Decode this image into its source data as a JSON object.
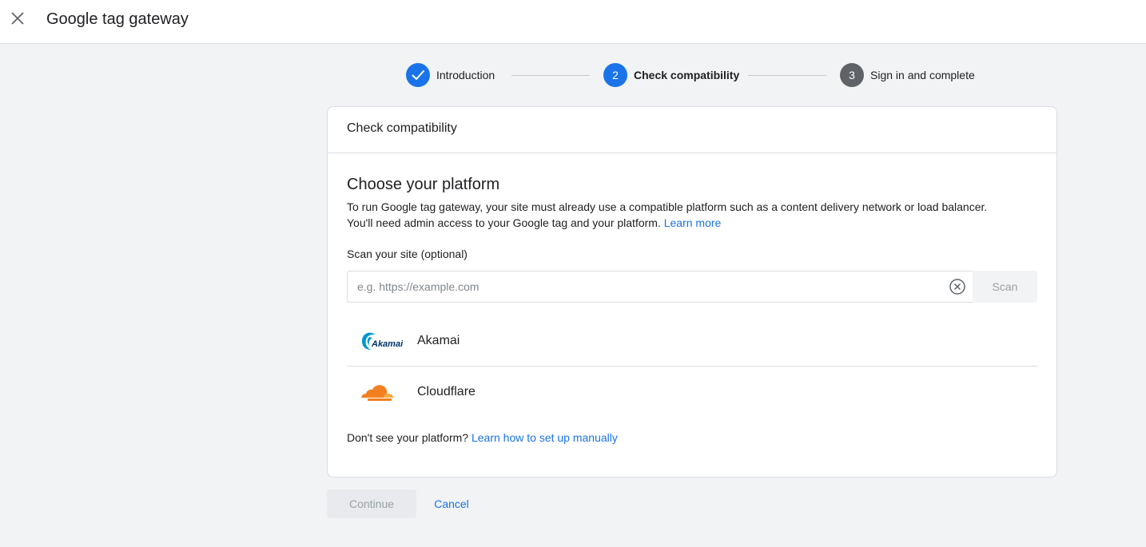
{
  "header": {
    "title": "Google tag gateway",
    "close_icon": "close-icon"
  },
  "stepper": {
    "steps": [
      {
        "number": "",
        "label": "Introduction",
        "state": "complete",
        "icon": "check-icon"
      },
      {
        "number": "2",
        "label": "Check compatibility",
        "state": "active"
      },
      {
        "number": "3",
        "label": "Sign in and complete",
        "state": "upcoming"
      }
    ]
  },
  "card": {
    "header_title": "Check compatibility",
    "section_title": "Choose your platform",
    "description_line1": "To run Google tag gateway, your site must already use a compatible platform such as a content delivery network or load balancer.",
    "description_line2": "You'll need admin access to your Google tag and your platform.",
    "learn_more": "Learn more",
    "scan_label": "Scan your site (optional)",
    "scan_placeholder": "e.g. https://example.com",
    "scan_value": "",
    "scan_button": "Scan",
    "platforms": [
      {
        "name": "Akamai",
        "logo": "akamai-logo",
        "logo_text": "Akamai"
      },
      {
        "name": "Cloudflare",
        "logo": "cloudflare-logo"
      }
    ],
    "manual_text": "Don't see your platform?",
    "manual_link": "Learn how to set up manually"
  },
  "actions": {
    "continue_label": "Continue",
    "cancel_label": "Cancel"
  },
  "colors": {
    "primary_blue": "#1a73e8",
    "step_upcoming": "#5f6368",
    "background": "#f1f3f4",
    "cloudflare_orange": "#f38020",
    "akamai_blue": "#0099cc"
  }
}
